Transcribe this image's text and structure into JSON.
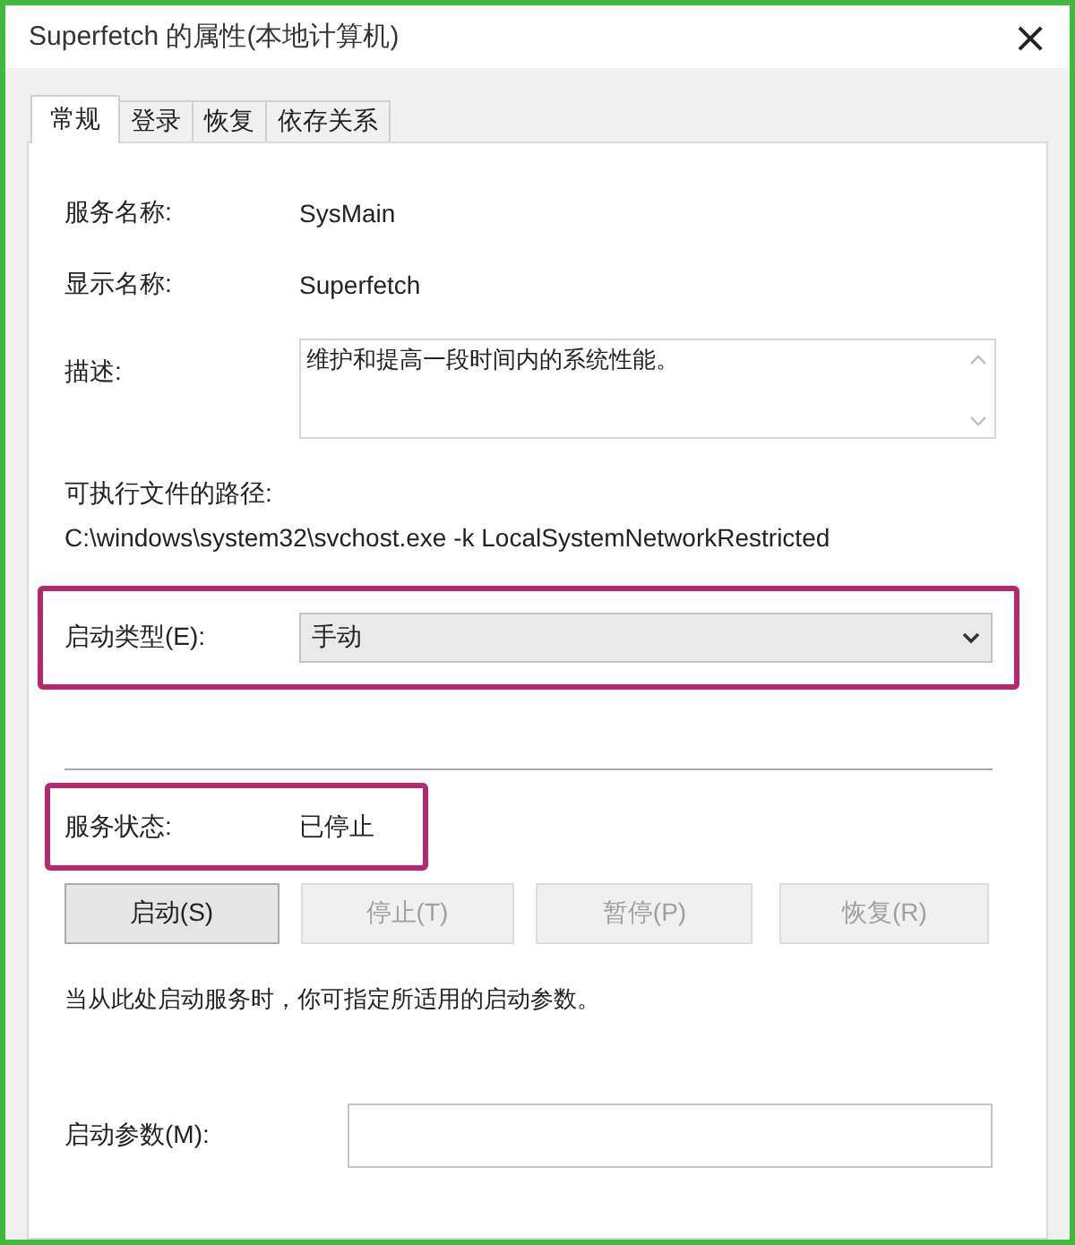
{
  "window": {
    "title": "Superfetch 的属性(本地计算机)",
    "close": "×"
  },
  "tabs": [
    {
      "label": "常规",
      "selected": true
    },
    {
      "label": "登录",
      "selected": false
    },
    {
      "label": "恢复",
      "selected": false
    },
    {
      "label": "依存关系",
      "selected": false
    }
  ],
  "service_name": {
    "label": "服务名称:",
    "value": "SysMain"
  },
  "display_name": {
    "label": "显示名称:",
    "value": "Superfetch"
  },
  "description": {
    "label": "描述:",
    "value": "维护和提高一段时间内的系统性能。"
  },
  "executable_path": {
    "label": "可执行文件的路径:",
    "value": "C:\\windows\\system32\\svchost.exe -k LocalSystemNetworkRestricted"
  },
  "startup_type": {
    "label": "启动类型(E):",
    "value": "手动",
    "highlighted": true
  },
  "service_status": {
    "label": "服务状态:",
    "value": "已停止",
    "highlighted": true
  },
  "buttons": [
    {
      "label": "启动(S)",
      "disabled": false
    },
    {
      "label": "停止(T)",
      "disabled": true
    },
    {
      "label": "暂停(P)",
      "disabled": true
    },
    {
      "label": "恢复(R)",
      "disabled": true
    }
  ],
  "note": "当从此处启动服务时，你可指定所适用的启动参数。",
  "start_parameters": {
    "label": "启动参数(M):"
  }
}
